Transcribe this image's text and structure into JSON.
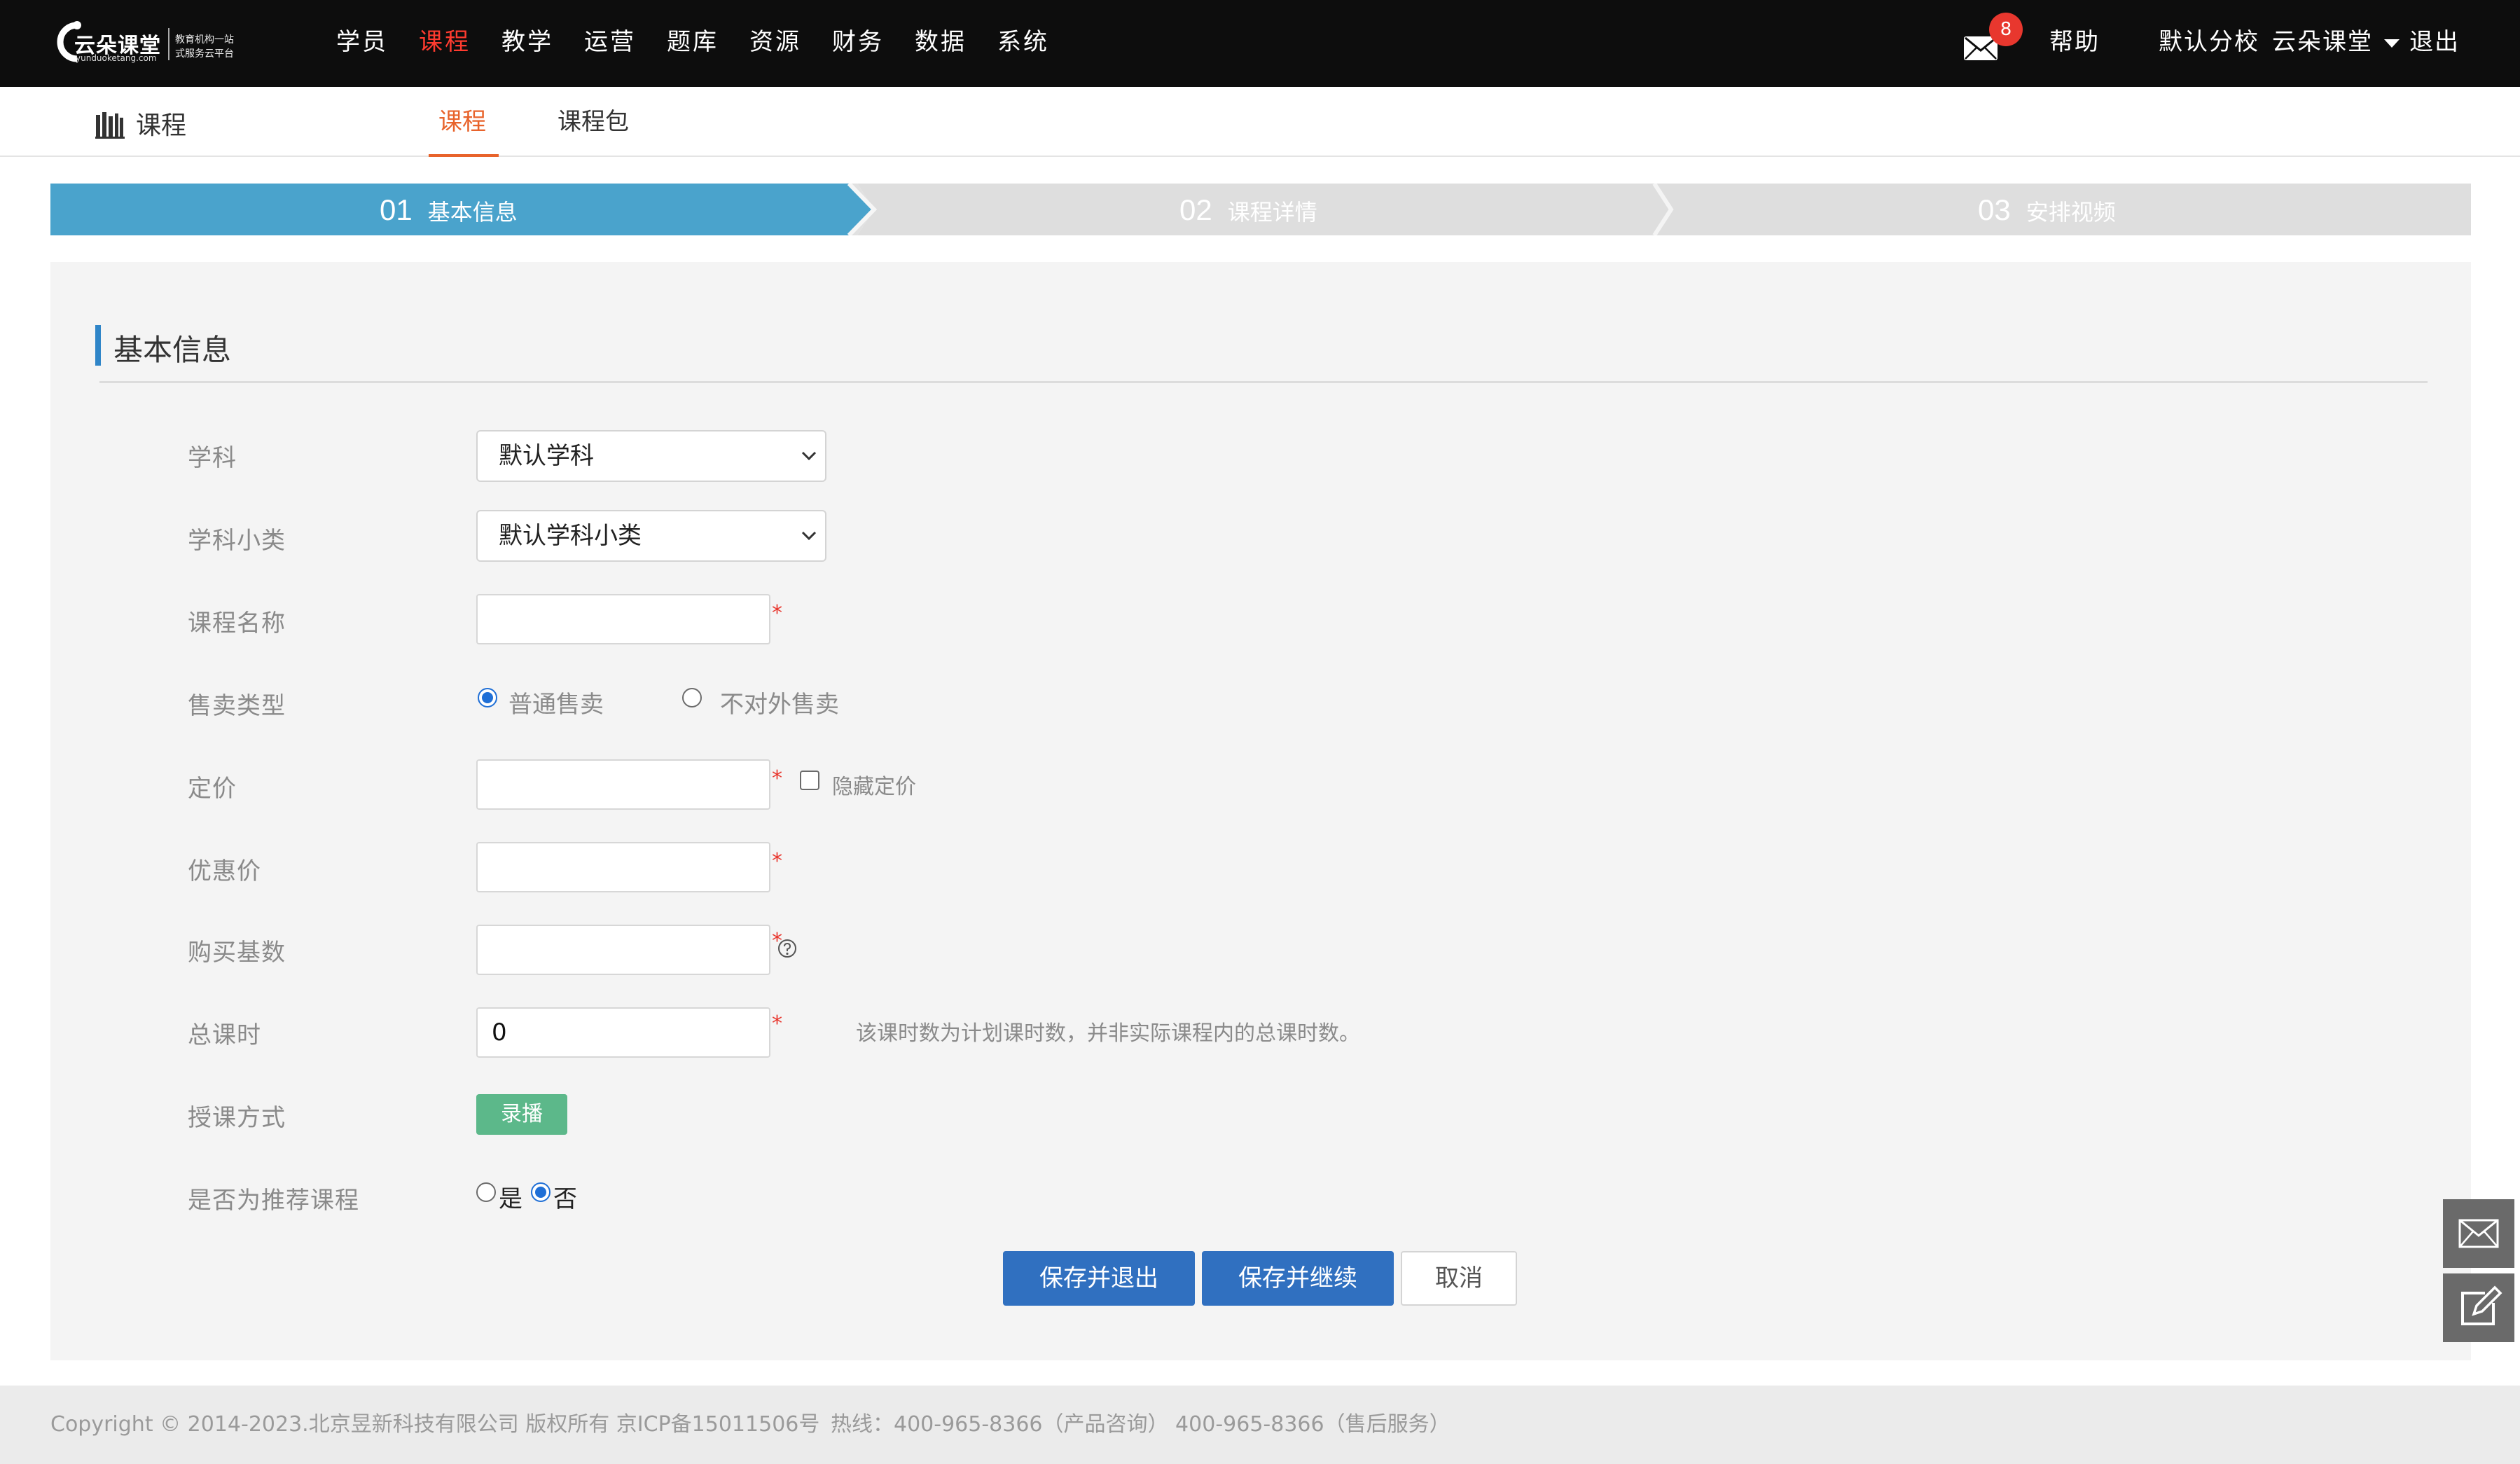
{
  "logo": {
    "name": "云朵课堂",
    "url": "yunduoketang.com",
    "slogan_line1": "教育机构一站",
    "slogan_line2": "式服务云平台"
  },
  "nav": {
    "items": [
      {
        "label": "学员"
      },
      {
        "label": "课程",
        "active": true
      },
      {
        "label": "教学"
      },
      {
        "label": "运营"
      },
      {
        "label": "题库"
      },
      {
        "label": "资源"
      },
      {
        "label": "财务"
      },
      {
        "label": "数据"
      },
      {
        "label": "系统"
      }
    ],
    "active_color": "#ff3b2f"
  },
  "header_right": {
    "mail_badge": "8",
    "help": "帮助",
    "school": "默认分校",
    "user": "云朵课堂",
    "logout": "退出"
  },
  "subheader": {
    "title": "课程",
    "tabs": [
      {
        "label": "课程",
        "active": true
      },
      {
        "label": "课程包"
      }
    ],
    "accent": "#e8632b"
  },
  "steps": [
    {
      "num": "01",
      "label": "基本信息",
      "active": true
    },
    {
      "num": "02",
      "label": "课程详情"
    },
    {
      "num": "03",
      "label": "安排视频"
    }
  ],
  "form": {
    "section_title": "基本信息",
    "subject": {
      "label": "学科",
      "value": "默认学科"
    },
    "subcategory": {
      "label": "学科小类",
      "value": "默认学科小类"
    },
    "course_name": {
      "label": "课程名称",
      "value": ""
    },
    "sale_type": {
      "label": "售卖类型",
      "options": [
        "普通售卖",
        "不对外售卖"
      ],
      "selected": "普通售卖"
    },
    "price": {
      "label": "定价",
      "value": "",
      "hide_price_label": "隐藏定价"
    },
    "discount_price": {
      "label": "优惠价",
      "value": ""
    },
    "purchase_base": {
      "label": "购买基数",
      "value": ""
    },
    "total_hours": {
      "label": "总课时",
      "value": "0",
      "hint": "该课时数为计划课时数，并非实际课程内的总课时数。"
    },
    "teaching_mode": {
      "label": "授课方式",
      "value": "录播"
    },
    "recommend": {
      "label": "是否为推荐课程",
      "options": [
        "是",
        "否"
      ],
      "selected": "否"
    },
    "required_mark": "*"
  },
  "actions": {
    "save_exit": "保存并退出",
    "save_continue": "保存并继续",
    "cancel": "取消"
  },
  "footer": {
    "copyright": "Copyright © 2014-2023.北京昱新科技有限公司 版权所有 京ICP备15011506号",
    "hotline": "热线：400-965-8366（产品咨询） 400-965-8366（售后服务）"
  },
  "icons": {
    "mail": "mail-icon",
    "books": "books-icon",
    "float_mail": "mail-icon",
    "float_edit": "edit-icon"
  }
}
